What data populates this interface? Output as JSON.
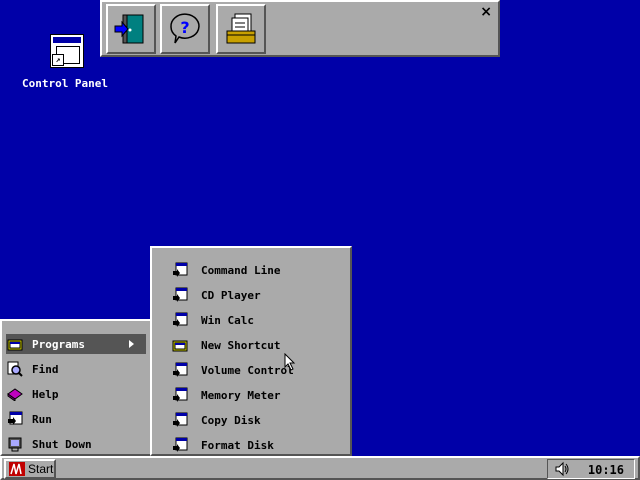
{
  "desktop": {
    "icons": [
      {
        "label": "Control Panel",
        "icon": "control-panel-icon"
      }
    ]
  },
  "toolbar": {
    "buttons": [
      {
        "icon": "exit-door-icon"
      },
      {
        "icon": "help-icon"
      },
      {
        "icon": "file-cabinet-icon"
      }
    ],
    "close_label": "×"
  },
  "start_menu": {
    "items": [
      {
        "label": "Programs",
        "icon": "programs-folder-icon",
        "has_submenu": true,
        "active": true
      },
      {
        "label": "Find",
        "icon": "find-magnifier-icon"
      },
      {
        "label": "Help",
        "icon": "help-book-icon"
      },
      {
        "label": "Run",
        "icon": "run-icon"
      },
      {
        "label": "Shut Down",
        "icon": "shutdown-icon"
      }
    ]
  },
  "programs_submenu": {
    "items": [
      {
        "label": "Command Line",
        "icon": "program-icon"
      },
      {
        "label": "CD Player",
        "icon": "program-icon"
      },
      {
        "label": "Win Calc",
        "icon": "program-icon"
      },
      {
        "label": "New Shortcut",
        "icon": "folder-icon"
      },
      {
        "label": "Volume Control",
        "icon": "program-icon"
      },
      {
        "label": "Memory Meter",
        "icon": "program-icon"
      },
      {
        "label": "Copy Disk",
        "icon": "program-icon"
      },
      {
        "label": "Format Disk",
        "icon": "program-icon"
      }
    ]
  },
  "taskbar": {
    "start_label": "Start",
    "clock": "10:16",
    "tray_icon": "speaker-icon"
  },
  "colors": {
    "desktop": "#0000a8",
    "face": "#aaaaaa",
    "highlight": "#555555"
  }
}
